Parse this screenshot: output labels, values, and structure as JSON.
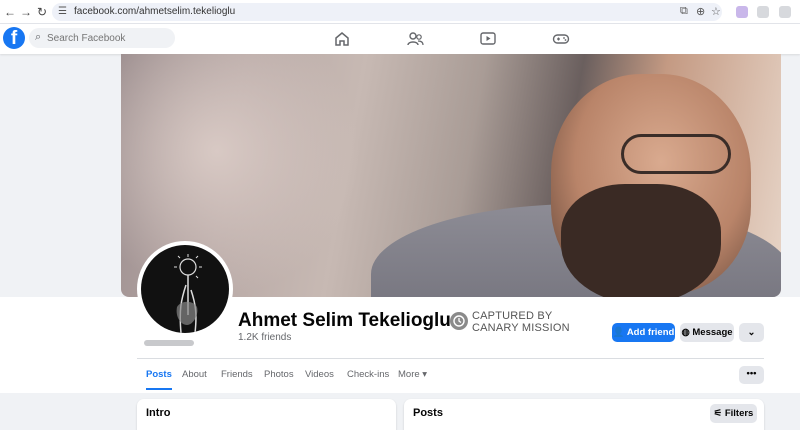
{
  "browser": {
    "url": "facebook.com/ahmetselim.tekelioglu"
  },
  "search": {
    "placeholder": "Search Facebook"
  },
  "profile": {
    "name": "Ahmet Selim Tekelioglu",
    "friends": "1.2K friends",
    "badge_line1": "CAPTURED BY",
    "badge_line2": "CANARY MISSION"
  },
  "actions": {
    "add_friend": "Add friend",
    "message": "Message",
    "more": "⌄"
  },
  "tabs": [
    {
      "label": "Posts"
    },
    {
      "label": "About"
    },
    {
      "label": "Friends"
    },
    {
      "label": "Photos"
    },
    {
      "label": "Videos"
    },
    {
      "label": "Check-ins"
    },
    {
      "label": "More ▾"
    }
  ],
  "tab_more": "•••",
  "cards": {
    "intro_title": "Intro",
    "posts_title": "Posts",
    "filters_label": "Filters"
  },
  "colors": {
    "brand": "#1877f2",
    "background": "#f0f2f5"
  },
  "icons": [
    "back-arrow-icon",
    "forward-arrow-icon",
    "reload-icon",
    "site-info-icon",
    "screen-share-icon",
    "zoom-icon",
    "bookmark-star-icon",
    "home-icon",
    "friends-icon",
    "watch-icon",
    "gaming-icon",
    "search-icon",
    "messenger-icon",
    "add-friend-icon",
    "filters-icon"
  ]
}
